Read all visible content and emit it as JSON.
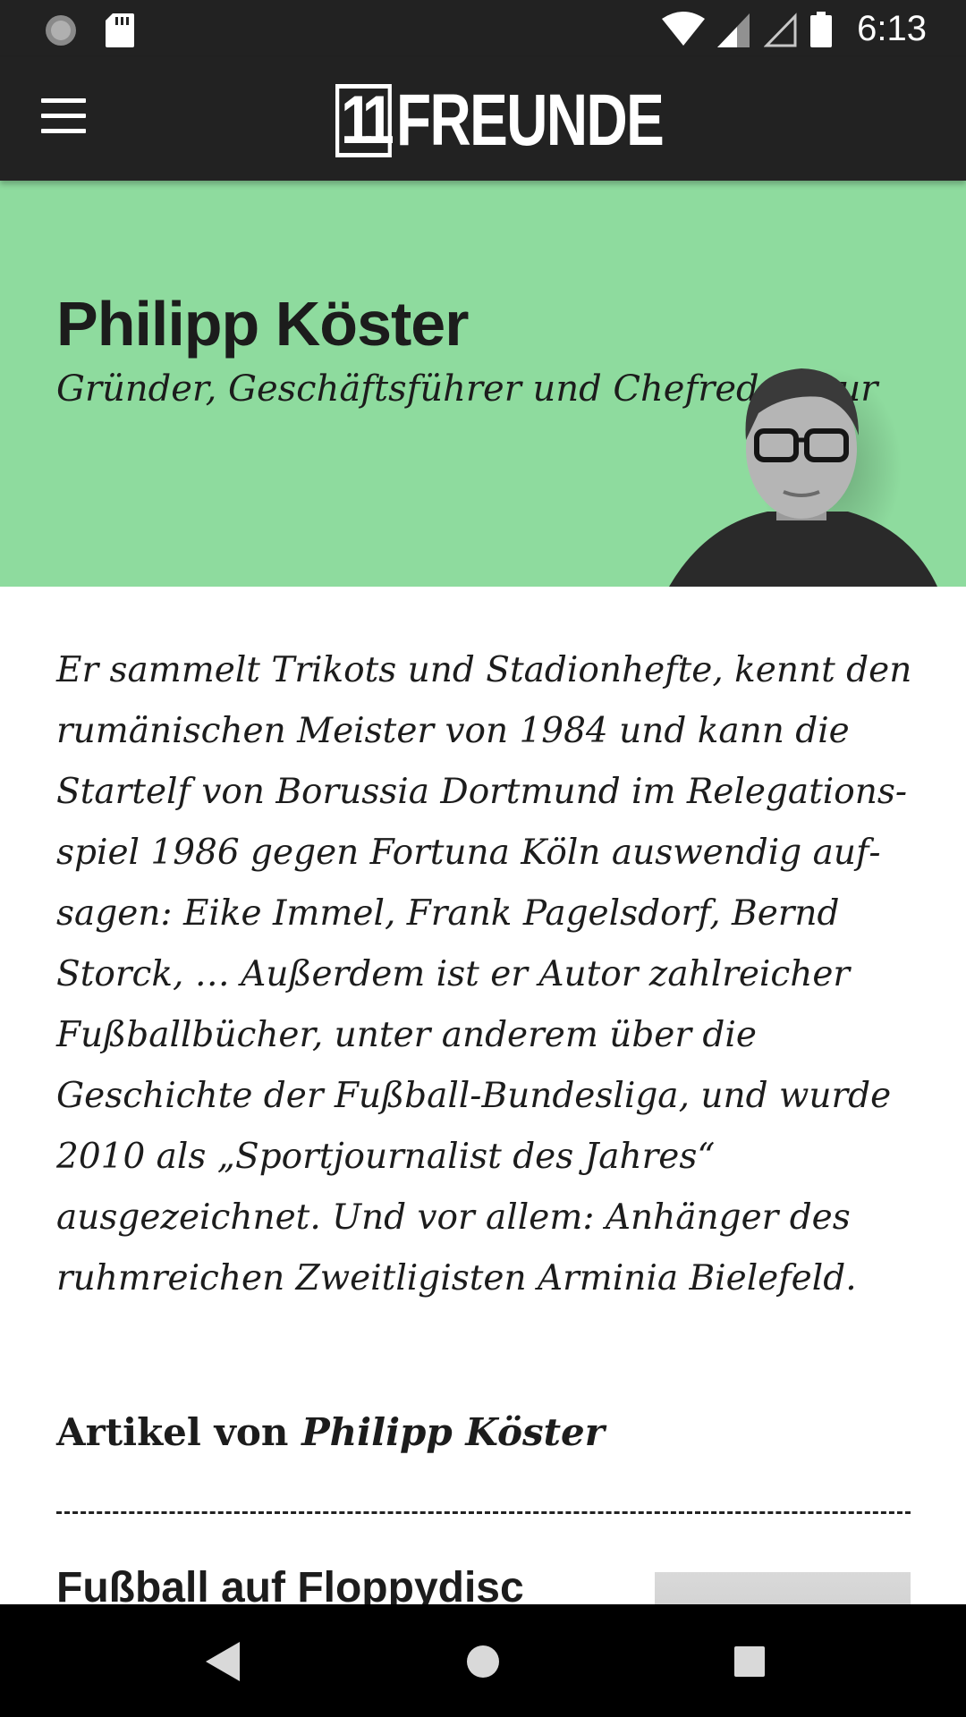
{
  "status_bar": {
    "time": "6:13",
    "icons": [
      "sync-icon",
      "sd-card-icon",
      "wifi-icon",
      "signal-icon",
      "signal-empty-icon",
      "battery-icon"
    ]
  },
  "app_bar": {
    "logo_number": "11",
    "logo_word": "FREUNDE",
    "menu_icon": "hamburger-menu-icon"
  },
  "author": {
    "name": "Philipp Köster",
    "role": "Gründer, Geschäftsführer und Chefredakteur",
    "hero_color": "#8edb9e",
    "bio": "Er sammelt Trikots und Stadionhefte, kennt den rumänischen Meister von 1984 und kann die Startelf von Borussia Dortmund im Relegations­spiel 1986 gegen Fortuna Köln auswendig auf­sagen: Eike Immel, Frank Pagelsdorf, Bernd Storck, … Außerdem ist er Autor zahlreicher Fuß­ballbücher, unter anderem über die Geschichte der Fußball-Bundesliga, und wurde 2010 als „Sport­journalist des Jahres“ ausgezeichnet. Und vor allem: Anhänger des ruhmreichen Zweitligisten Arminia Bielefeld."
  },
  "articles": {
    "heading_prefix": "Artikel von",
    "heading_author": "Philipp Köster",
    "items": [
      {
        "title": "Fußball auf Floppydisc"
      }
    ]
  },
  "nav_bar": {
    "back_icon": "back-triangle-icon",
    "home_icon": "home-circle-icon",
    "recents_icon": "recents-square-icon"
  }
}
